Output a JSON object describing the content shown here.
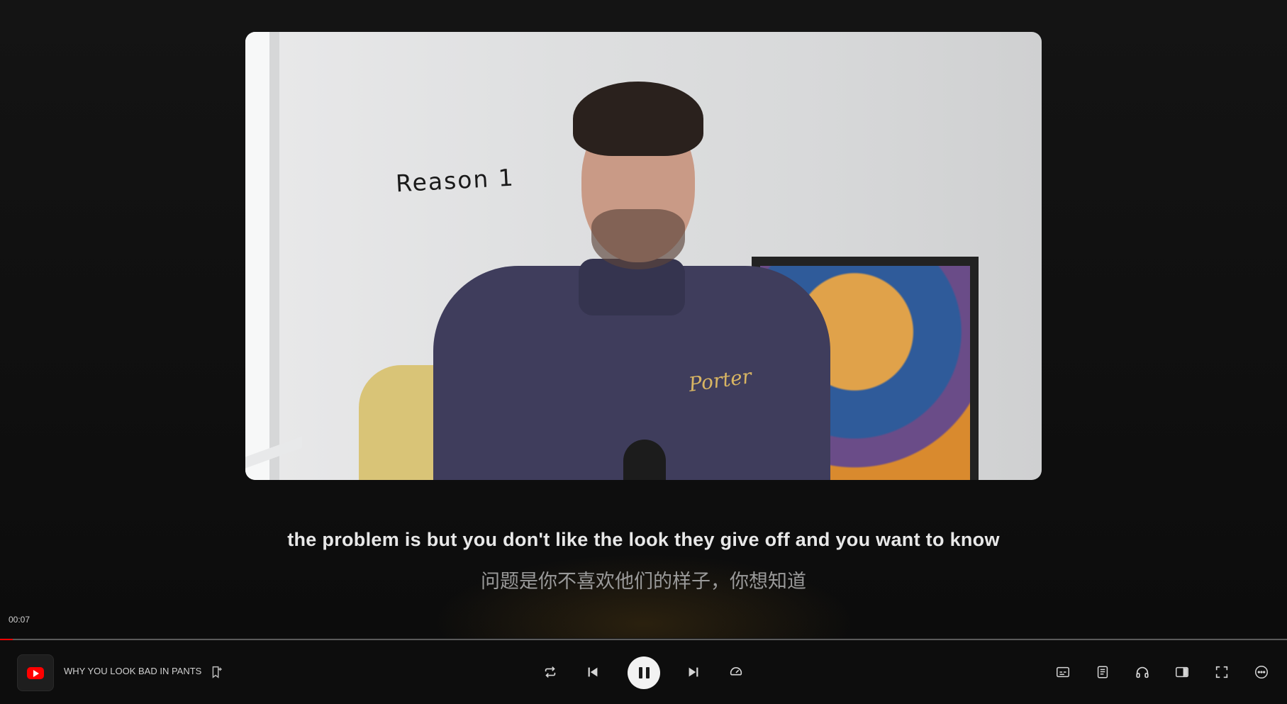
{
  "video": {
    "overlay_text": "Reason 1",
    "jacket_text": "Porter"
  },
  "subtitles": {
    "english": "the problem is but you don't like the look they give off and you want to know",
    "chinese": "问题是你不喜欢他们的样子，你想知道"
  },
  "playback": {
    "current_time": "00:07",
    "progress_fraction": 0.01
  },
  "player": {
    "title": "WHY YOU LOOK BAD IN PANTS",
    "source_icon": "youtube-icon",
    "controls": [
      "repeat-icon",
      "previous-icon",
      "pause-icon",
      "next-icon",
      "speed-icon"
    ],
    "right_tools": [
      "captions-icon",
      "transcript-icon",
      "headphones-icon",
      "sidebar-icon",
      "fullscreen-icon",
      "more-icon"
    ]
  },
  "colors": {
    "accent": "#ff0000",
    "background": "#121212"
  }
}
